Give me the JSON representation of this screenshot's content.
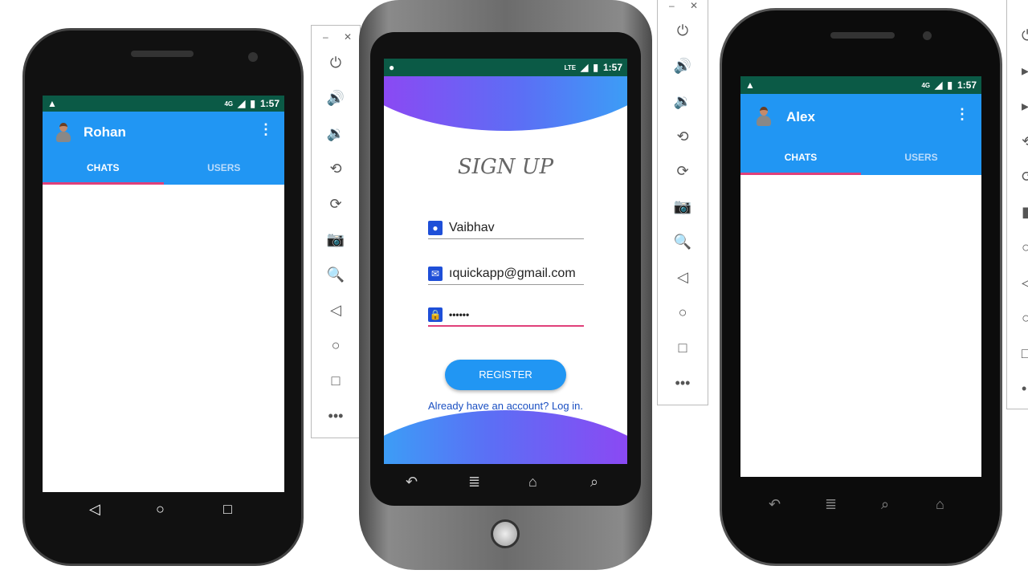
{
  "left_phone": {
    "status": {
      "time": "1:57",
      "network": "4G"
    },
    "appbar": {
      "title": "Rohan"
    },
    "tabs": [
      {
        "label": "CHATS",
        "active": true
      },
      {
        "label": "USERS",
        "active": false
      }
    ]
  },
  "middle_phone": {
    "status": {
      "time": "1:57",
      "network": "LTE"
    },
    "heading": "SIGN UP",
    "fields": {
      "name": "Vaibhav",
      "email": "ıquickapp@gmail.com",
      "password": "••••••"
    },
    "register_label": "REGISTER",
    "login_link": "Already have an account? Log in.",
    "gradient": [
      "#9b3cf2",
      "#5b6ff5",
      "#2eb2f7"
    ]
  },
  "right_phone": {
    "status": {
      "time": "1:57",
      "network": "4G"
    },
    "appbar": {
      "title": "Alex"
    },
    "tabs": [
      {
        "label": "CHATS",
        "active": true
      },
      {
        "label": "USERS",
        "active": false
      }
    ]
  },
  "colors": {
    "appbar": "#2196f3",
    "statusbar": "#0b5a46",
    "indicator": "#e0407a",
    "accent_field": "#e0407a"
  },
  "toolbar_icons": [
    "power-icon",
    "volume-up-icon",
    "volume-down-icon",
    "rotate-left-icon",
    "rotate-right-icon",
    "camera-icon",
    "zoom-icon",
    "back-icon",
    "home-icon",
    "overview-icon",
    "more-icon"
  ]
}
